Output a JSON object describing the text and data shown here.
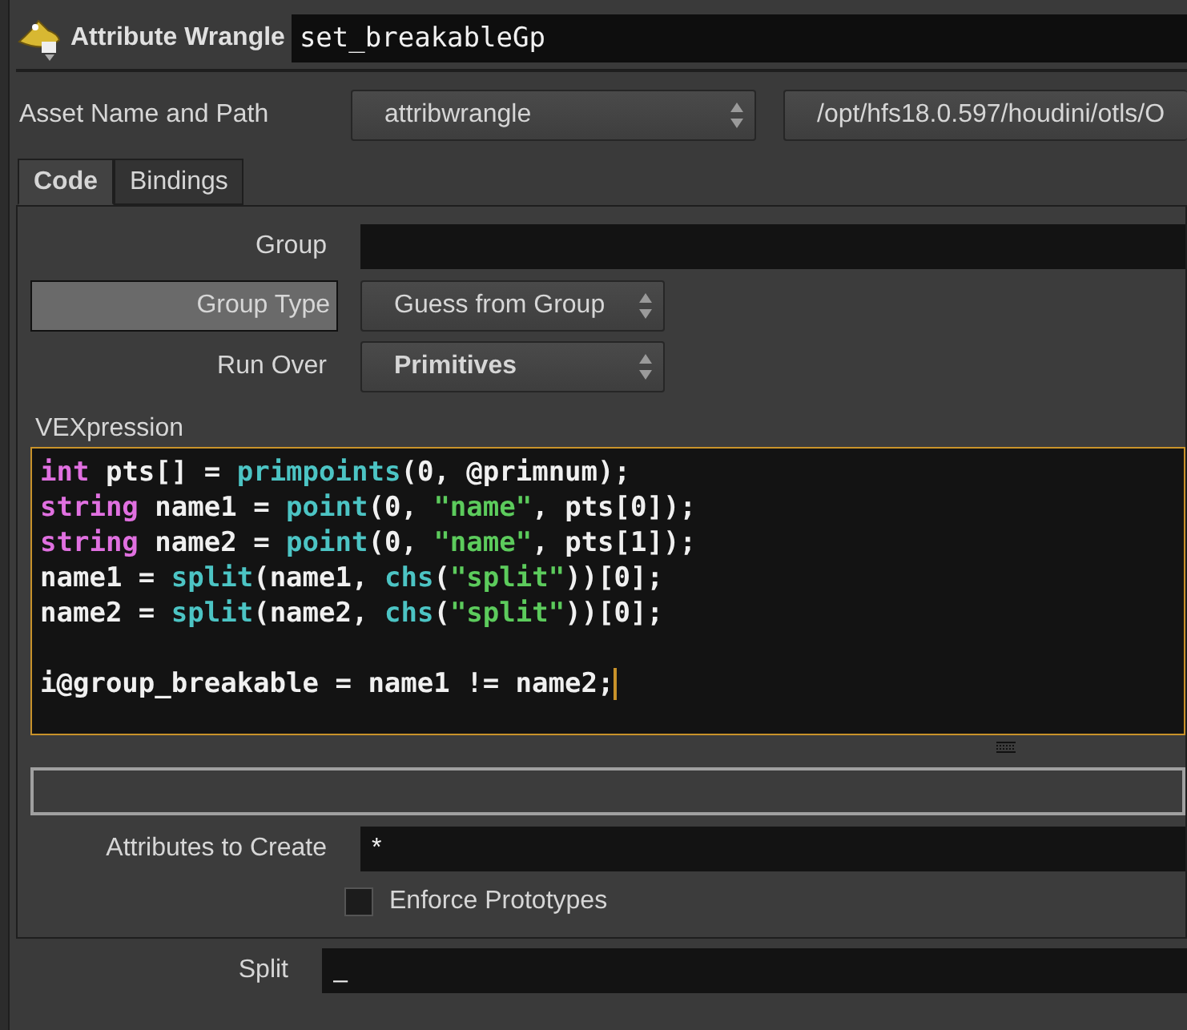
{
  "header": {
    "node_type": "Attribute Wrangle",
    "node_name": "set_breakableGp"
  },
  "asset": {
    "label": "Asset Name and Path",
    "name": "attribwrangle",
    "path": "/opt/hfs18.0.597/houdini/otls/O"
  },
  "tabs": [
    {
      "label": "Code",
      "selected": true
    },
    {
      "label": "Bindings",
      "selected": false
    }
  ],
  "group": {
    "label": "Group"
  },
  "group_type": {
    "label": "Group Type",
    "value": "Guess from Group"
  },
  "run_over": {
    "label": "Run Over",
    "value": "Primitives"
  },
  "vex": {
    "label": "VEXpression",
    "lines": [
      {
        "kind": "code",
        "tokens": [
          {
            "kind": "keyword",
            "text": "int"
          },
          {
            "kind": "plain",
            "text": " pts[] = "
          },
          {
            "kind": "function",
            "text": "primpoints"
          },
          {
            "kind": "plain",
            "text": "(0, @primnum);"
          }
        ]
      },
      {
        "kind": "code",
        "tokens": [
          {
            "kind": "keyword",
            "text": "string"
          },
          {
            "kind": "plain",
            "text": " name1 = "
          },
          {
            "kind": "function",
            "text": "point"
          },
          {
            "kind": "plain",
            "text": "(0, "
          },
          {
            "kind": "string",
            "text": "\"name\""
          },
          {
            "kind": "plain",
            "text": ", pts[0]);"
          }
        ]
      },
      {
        "kind": "code",
        "tokens": [
          {
            "kind": "keyword",
            "text": "string"
          },
          {
            "kind": "plain",
            "text": " name2 = "
          },
          {
            "kind": "function",
            "text": "point"
          },
          {
            "kind": "plain",
            "text": "(0, "
          },
          {
            "kind": "string",
            "text": "\"name\""
          },
          {
            "kind": "plain",
            "text": ", pts[1]);"
          }
        ]
      },
      {
        "kind": "code",
        "tokens": [
          {
            "kind": "plain",
            "text": "name1 = "
          },
          {
            "kind": "function",
            "text": "split"
          },
          {
            "kind": "plain",
            "text": "(name1, "
          },
          {
            "kind": "function",
            "text": "chs"
          },
          {
            "kind": "plain",
            "text": "("
          },
          {
            "kind": "string",
            "text": "\"split\""
          },
          {
            "kind": "plain",
            "text": "))[0];"
          }
        ]
      },
      {
        "kind": "code",
        "tokens": [
          {
            "kind": "plain",
            "text": "name2 = "
          },
          {
            "kind": "function",
            "text": "split"
          },
          {
            "kind": "plain",
            "text": "(name2, "
          },
          {
            "kind": "function",
            "text": "chs"
          },
          {
            "kind": "plain",
            "text": "("
          },
          {
            "kind": "string",
            "text": "\"split\""
          },
          {
            "kind": "plain",
            "text": "))[0];"
          }
        ]
      },
      {
        "kind": "blank"
      },
      {
        "kind": "code",
        "tokens": [
          {
            "kind": "plain",
            "text": "i@group_breakable = name1 != name2;"
          }
        ]
      }
    ]
  },
  "attributes_to_create": {
    "label": "Attributes to Create",
    "value": "*"
  },
  "enforce_prototypes": {
    "label": "Enforce Prototypes",
    "checked": false
  },
  "split": {
    "label": "Split",
    "value": "_"
  }
}
